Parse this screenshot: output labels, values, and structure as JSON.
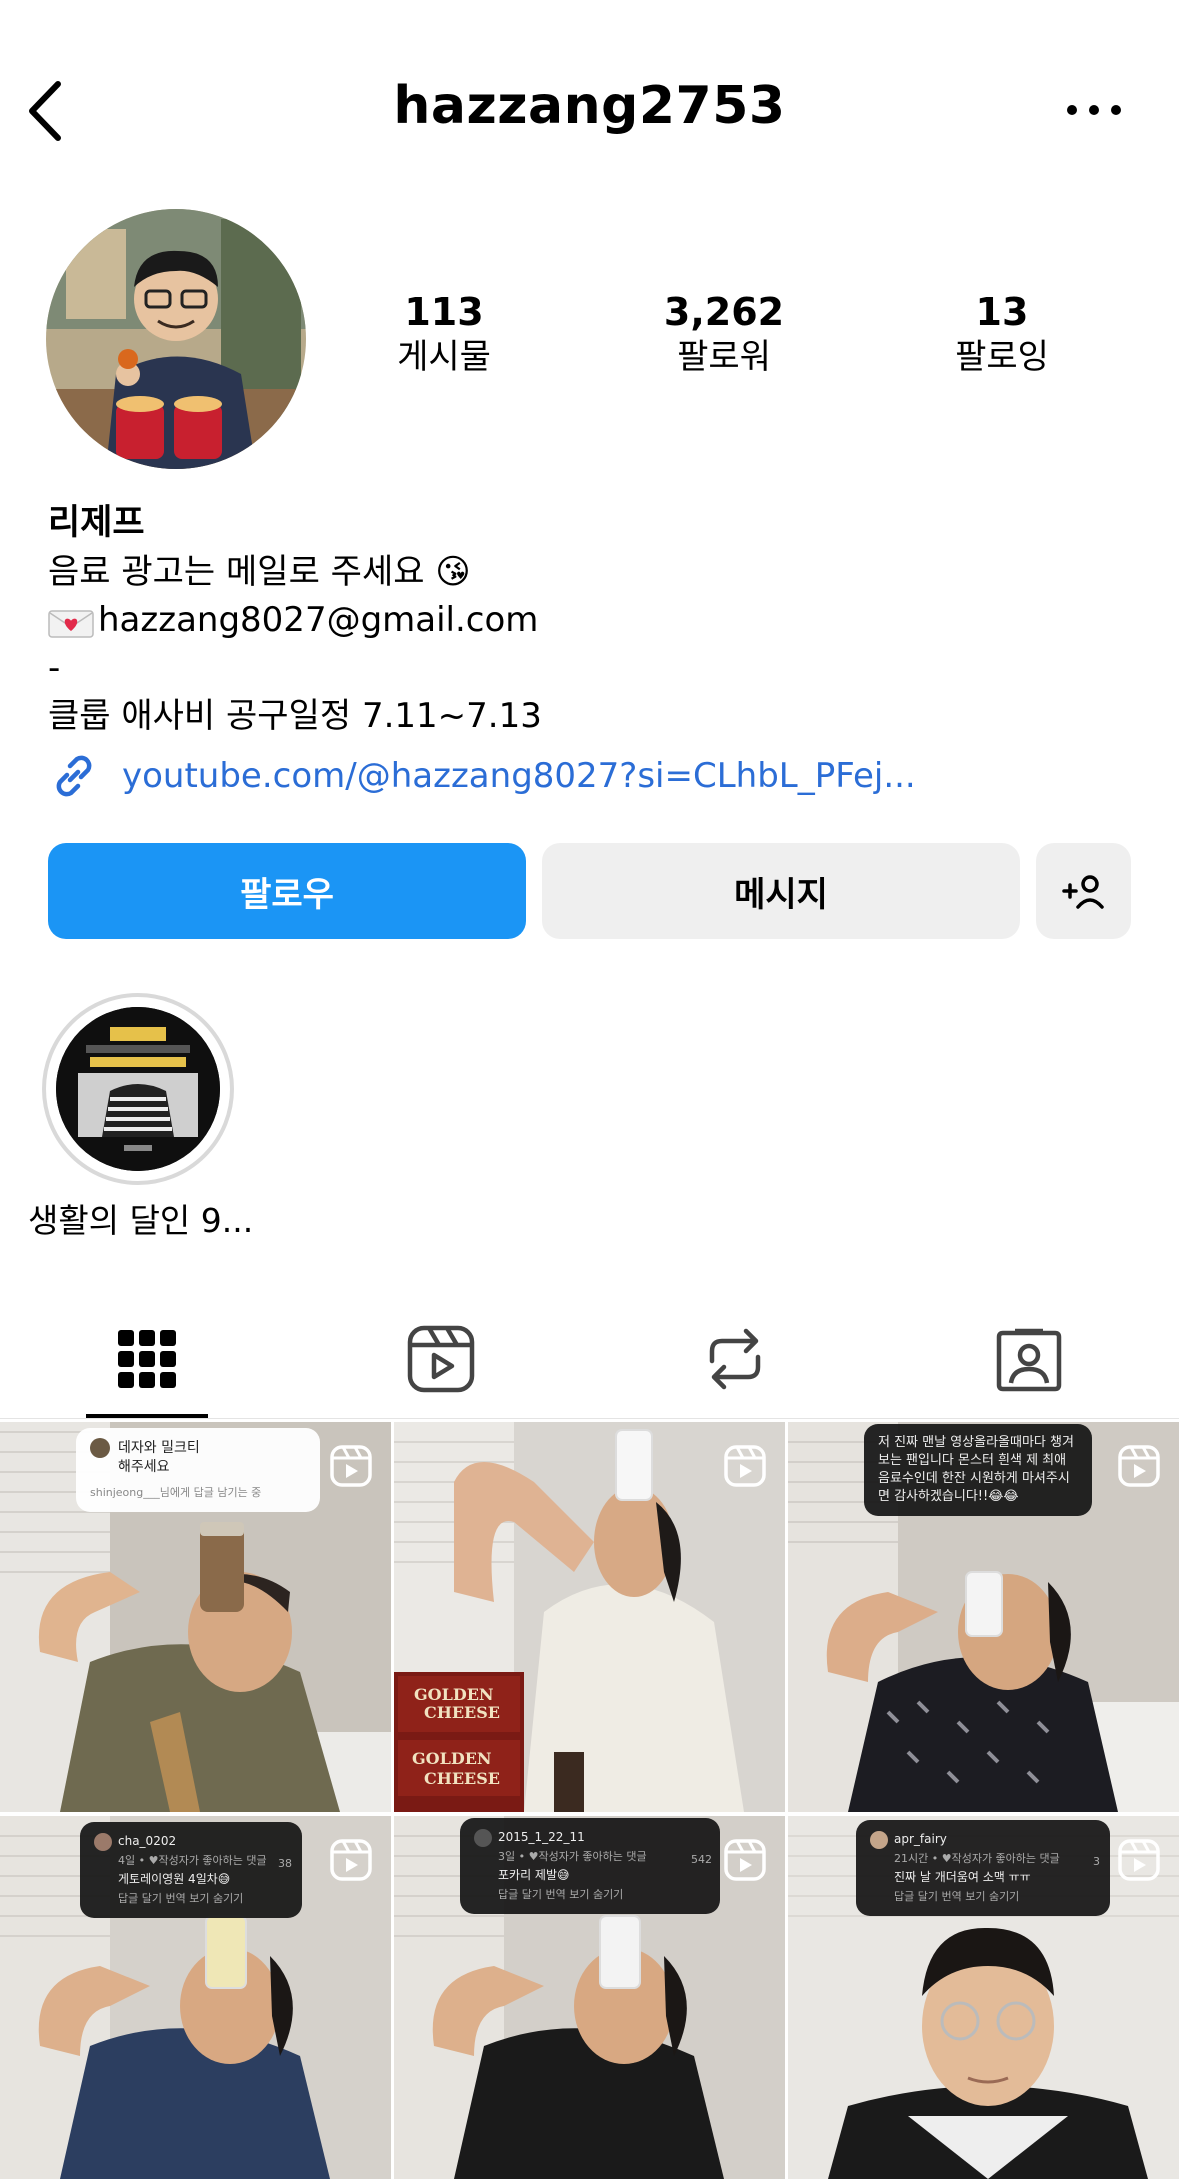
{
  "header": {
    "username": "hazzang2753"
  },
  "stats": [
    {
      "value": "113",
      "label": "게시물"
    },
    {
      "value": "3,262",
      "label": "팔로워"
    },
    {
      "value": "13",
      "label": "팔로잉"
    }
  ],
  "bio": {
    "name": "리제프",
    "line1": "음료 광고는 메일로 주세요 😘",
    "email": "hazzang8027@gmail.com",
    "dash": "-",
    "line3": "클룹 애사비 공구일정 7.11~7.13",
    "link": "youtube.com/@hazzang8027?si=CLhbL_PFej..."
  },
  "buttons": {
    "follow": "팔로우",
    "message": "메시지"
  },
  "highlights": [
    {
      "label": "생활의 달인 9..."
    }
  ],
  "colors": {
    "accent": "#1b95f5",
    "link": "#2b6dd6"
  },
  "grid": [
    {
      "comment_user": "데자와 밀크티",
      "comment_text": "해주세요",
      "comment_sub": "shinjeong___님에게 답글 남기는 중"
    },
    {
      "comment_user": "",
      "comment_text": ""
    },
    {
      "comment_user": "",
      "comment_text": "저 진짜 맨날 영상올라올때마다 챙겨보는 팬입니다 몬스터 흰색 제 최애음료수인데 한잔 시원하게 마셔주시면 감사하겠습니다!!😂😂"
    },
    {
      "comment_user": "cha_0202",
      "comment_meta": "4일 • ♥작성자가 좋아하는 댓글",
      "comment_text": "게토레이영원 4일차😅",
      "comment_actions": "답글 달기   번역 보기   숨기기",
      "comment_count": "38"
    },
    {
      "comment_user": "2015_1_22_11",
      "comment_meta": "3일 • ♥작성자가 좋아하는 댓글",
      "comment_text": "포카리 제발😅",
      "comment_actions": "답글 달기   번역 보기   숨기기",
      "comment_count": "542"
    },
    {
      "comment_user": "apr_fairy",
      "comment_meta": "21시간 • ♥작성자가 좋아하는 댓글",
      "comment_text": "진짜 날 개더움여 소맥 ㅠㅠ",
      "comment_actions": "답글 달기   번역 보기   숨기기",
      "comment_count": "3"
    }
  ]
}
